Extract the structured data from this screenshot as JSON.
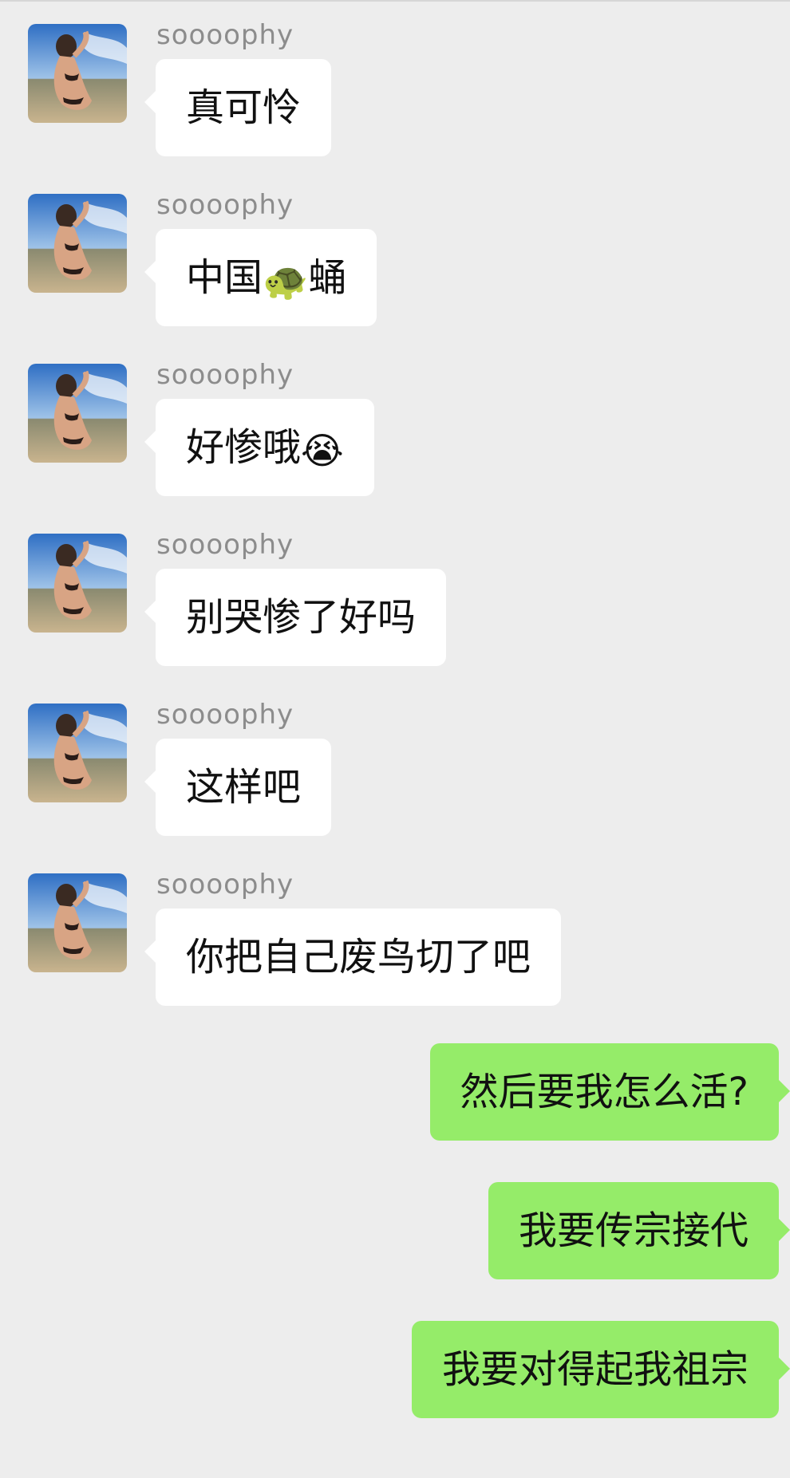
{
  "messages_in": [
    {
      "sender": "soooophy",
      "text": "真可怜"
    },
    {
      "sender": "soooophy",
      "text_before": "中国",
      "emoji": "🐢",
      "text_after": "蛹"
    },
    {
      "sender": "soooophy",
      "text": "好惨哦",
      "emoji": "😭"
    },
    {
      "sender": "soooophy",
      "text": "别哭惨了好吗"
    },
    {
      "sender": "soooophy",
      "text": "这样吧"
    },
    {
      "sender": "soooophy",
      "text": "你把自己废鸟切了吧"
    }
  ],
  "messages_out": [
    {
      "text": "然后要我怎么活?"
    },
    {
      "text": "我要传宗接代"
    },
    {
      "text": "我要对得起我祖宗"
    }
  ],
  "colors": {
    "background": "#ededed",
    "incoming_bubble": "#ffffff",
    "outgoing_bubble": "#95ec69",
    "sender_name": "#8c8c8c"
  }
}
